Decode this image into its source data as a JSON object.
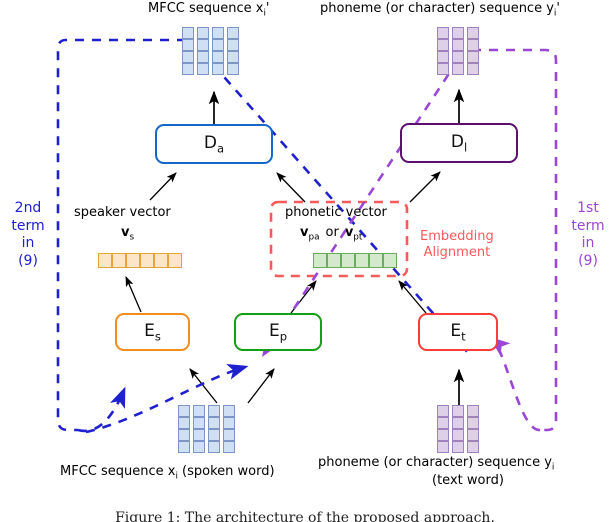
{
  "figure": {
    "title_top_left": "MFCC sequence xᵢ'",
    "title_top_right": "phoneme (or character) sequence yᵢ'",
    "caption": "Figure 1: The architecture of the proposed approach."
  },
  "labels": {
    "mfcc_out": {
      "pre": "MFCC sequence x",
      "sub": "i",
      "post": "'"
    },
    "phoneme_out": {
      "pre": "phoneme (or character) sequence y",
      "sub": "i",
      "post": "'"
    },
    "mfcc_in": {
      "pre": "MFCC sequence x",
      "sub": "i",
      "post": " (spoken word)"
    },
    "phoneme_in": {
      "pre": "phoneme (or character) sequence y",
      "sub": "i",
      "post": ""
    },
    "phoneme_in_line2": "(text word)",
    "speaker_vector": "speaker vector",
    "speaker_vector_symbol": {
      "bold": "v",
      "sub": "s"
    },
    "phonetic_vector": "phonetic vector",
    "phonetic_vector_symbol_1": {
      "bold": "v",
      "sub": "pa"
    },
    "phonetic_vector_or": "or",
    "phonetic_vector_symbol_2": {
      "bold": "v",
      "sub": "pt"
    },
    "embedding_alignment_line1": "Embedding",
    "embedding_alignment_line2": "Alignment"
  },
  "modules": {
    "decoder_audio": {
      "name": "D",
      "sub": "a",
      "color": "#1567c8"
    },
    "decoder_language": {
      "name": "D",
      "sub": "l",
      "color": "#5b1070"
    },
    "encoder_speaker": {
      "name": "E",
      "sub": "s",
      "color": "#f28c1c"
    },
    "encoder_phonetic": {
      "name": "E",
      "sub": "p",
      "color": "#14a014"
    },
    "encoder_text": {
      "name": "E",
      "sub": "t",
      "color": "#fa3c3c"
    }
  },
  "terms": {
    "second_term": {
      "l1": "2nd",
      "l2": "term",
      "l3": "in",
      "l4": "(9)",
      "color": "#1f20d0"
    },
    "first_term": {
      "l1": "1st",
      "l2": "term",
      "l3": "in",
      "l4": "(9)",
      "color": "#9a46d6"
    }
  },
  "colors": {
    "blue_dashed": "#1f20d0",
    "purple_dashed": "#9a46d6",
    "red_dashed": "#fa5a5a",
    "mfcc_block_fill": "#cfe0f4",
    "mfcc_block_stroke": "#7d9fd0",
    "phoneme_block_fill": "#ddd0e8",
    "phoneme_block_stroke": "#9f7fbf",
    "speaker_bar_fill": "#fde5c8",
    "speaker_bar_stroke": "#e8a33d",
    "phonetic_bar_fill": "#d4e8cc",
    "phonetic_bar_stroke": "#6aab5e",
    "arrow_black": "#000000"
  },
  "blocks": {
    "mfcc_out_grid": {
      "cols": 4,
      "rows": 4
    },
    "phoneme_out_grid": {
      "cols": 3,
      "rows": 4
    },
    "mfcc_in_grid": {
      "cols": 4,
      "rows": 4
    },
    "phoneme_in_grid": {
      "cols": 3,
      "rows": 4
    },
    "speaker_bar_cells": 6,
    "phonetic_bar_cells": 6
  }
}
